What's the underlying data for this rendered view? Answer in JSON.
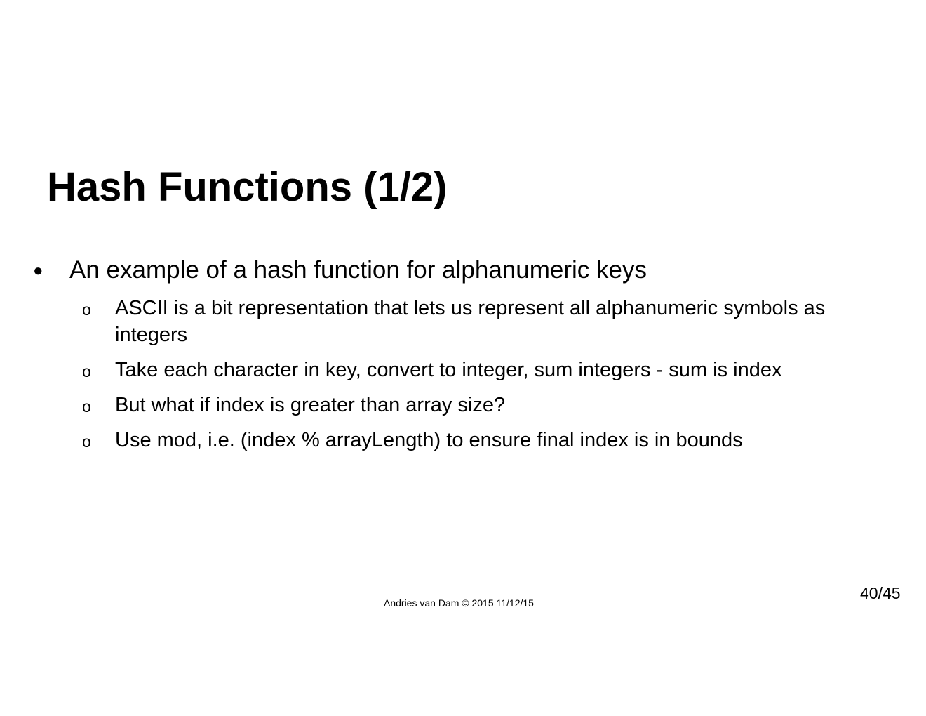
{
  "slide": {
    "title": "Hash Functions (1/2)",
    "bullet": {
      "glyph": "●",
      "text": "An example of a hash function for alphanumeric keys"
    },
    "sub_bullets": [
      {
        "glyph": "o",
        "text": "ASCII is a bit representation that lets us represent all alphanumeric symbols as integers"
      },
      {
        "glyph": "o",
        "text": "Take each character in key, convert to integer, sum integers - sum is index"
      },
      {
        "glyph": "o",
        "text": "But what if index is greater than array size?"
      },
      {
        "glyph": "o",
        "text": "Use mod, i.e. (index % arrayLength) to ensure final index is in bounds"
      }
    ],
    "footer": "Andries van Dam © 2015 11/12/15",
    "page_number": "40/45"
  }
}
